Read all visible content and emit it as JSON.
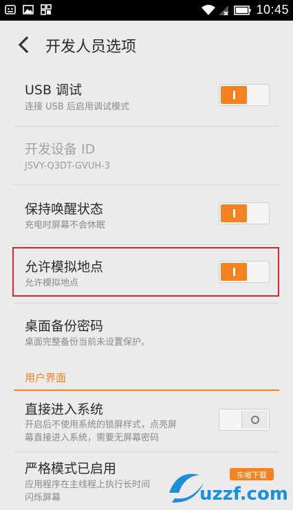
{
  "status_bar": {
    "time": "10:45",
    "left_icons": [
      "notification-app-icon",
      "image-icon",
      "grid-icon"
    ],
    "right_icons": [
      "wifi-icon",
      "no-signal-icon",
      "battery-icon"
    ]
  },
  "header": {
    "title": "开发人员选项"
  },
  "settings": [
    {
      "title": "USB 调试",
      "subtitle": "连接 USB 后启用调试模式",
      "toggle": "on"
    },
    {
      "title": "开发设备 ID",
      "subtitle": "JSVY-Q3DT-GVUH-3",
      "disabled": true
    },
    {
      "title": "保持唤醒状态",
      "subtitle": "充电时屏幕不会休眠",
      "toggle": "on"
    },
    {
      "title": "允许模拟地点",
      "subtitle": "允许模拟地点",
      "toggle": "on",
      "highlighted": true
    },
    {
      "title": "桌面备份密码",
      "subtitle": "桌面完整备份当前未设置保护。"
    }
  ],
  "section": {
    "label": "用户界面"
  },
  "ui_settings": [
    {
      "title": "直接进入系统",
      "subtitle_line1": "开启后不使用系统的锁屏样式，点亮屏",
      "subtitle_line2": "幕直接进入系统，需要无屏幕密码",
      "toggle": "off"
    },
    {
      "title": "严格模式已启用",
      "subtitle_line1": "应用程序在主线程上执行长时间",
      "subtitle_line2": "闪烁屏幕"
    }
  ],
  "watermark": {
    "text_main": "uzzf.com",
    "text_badge": "东坡下载"
  },
  "colors": {
    "accent": "#f58220",
    "highlight_border": "#d8282c",
    "background": "#ebebeb"
  }
}
